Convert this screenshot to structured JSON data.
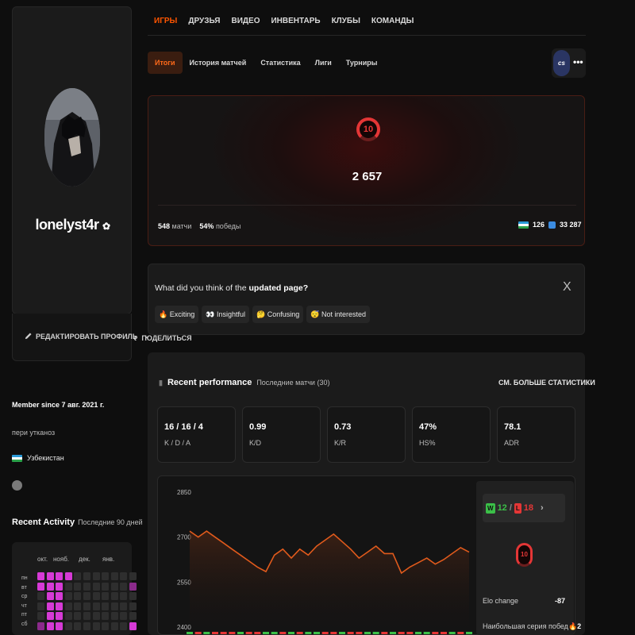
{
  "profile": {
    "username": "lonelyst4r",
    "edit_label": "РЕДАКТИРОВАТЬ ПРОФИЛЬ",
    "share_label": "ПОДЕЛИТЬСЯ",
    "member_since": "Member since 7 авг. 2021 г.",
    "bio": "пери утканоз",
    "country": "Узбекистан"
  },
  "activity": {
    "title": "Recent Activity",
    "subtitle": "Последние 90 дней",
    "months": [
      "окт.",
      "нояб.",
      "дек.",
      "янв."
    ],
    "days": [
      "пн",
      "вт",
      "ср",
      "чт",
      "пт",
      "сб"
    ]
  },
  "nav": {
    "tabs": [
      "ИГРЫ",
      "ДРУЗЬЯ",
      "ВИДЕО",
      "ИНВЕНТАРЬ",
      "КЛУБЫ",
      "КОМАНДЫ"
    ],
    "active": "ИГРЫ"
  },
  "subtabs": {
    "items": [
      "Итоги",
      "История матчей",
      "Статистика",
      "Лиги",
      "Турниры"
    ],
    "active": "Итоги",
    "game_badge": "cs",
    "more": "•••"
  },
  "elo": {
    "level": "10",
    "value": "2 657",
    "matches": "548",
    "matches_label": "матчи",
    "winrate": "54%",
    "winrate_label": "победы",
    "country_rank": "126",
    "world_rank": "33 287",
    "accent": "#e43636"
  },
  "feedback": {
    "question_prefix": "What did you think of the",
    "question_bold": "updated page?",
    "close": "X",
    "options": [
      {
        "icon": "🔥",
        "label": "Exciting"
      },
      {
        "icon": "👀",
        "label": "Insightful"
      },
      {
        "icon": "🤔",
        "label": "Confusing"
      },
      {
        "icon": "😴",
        "label": "Not interested"
      }
    ]
  },
  "performance": {
    "title": "Recent performance",
    "subtitle": "Последние матчи (30)",
    "more_link": "СМ. БОЛЬШЕ СТАТИСТИКИ",
    "stats": [
      {
        "value": "16 / 16 / 4",
        "label": "K / D / A"
      },
      {
        "value": "0.99",
        "label": "K/D"
      },
      {
        "value": "0.73",
        "label": "K/R"
      },
      {
        "value": "47%",
        "label": "HS%"
      },
      {
        "value": "78.1",
        "label": "ADR"
      }
    ],
    "wins": "12",
    "losses": "18",
    "wins_badge": "W",
    "losses_badge": "L",
    "elo_level": "10",
    "elo_change_label": "Elo change",
    "elo_change": "-87",
    "streak_label": "Наибольшая серия побед",
    "streak": "2"
  },
  "chart_data": {
    "type": "line",
    "yticks": [
      2850,
      2700,
      2550,
      2400
    ],
    "ylim": [
      2400,
      2850
    ],
    "values": [
      2720,
      2700,
      2720,
      2700,
      2680,
      2660,
      2640,
      2620,
      2600,
      2585,
      2640,
      2660,
      2630,
      2660,
      2640,
      2670,
      2690,
      2710,
      2685,
      2660,
      2630,
      2650,
      2670,
      2645,
      2645,
      2580,
      2600,
      2615,
      2630,
      2610,
      2625,
      2645,
      2665,
      2650
    ],
    "line_color": "#e05a1c",
    "results": [
      "W",
      "L",
      "W",
      "L",
      "L",
      "L",
      "W",
      "L",
      "L",
      "W",
      "W",
      "L",
      "W",
      "L",
      "W",
      "W",
      "L",
      "L",
      "W",
      "L",
      "L",
      "W",
      "W",
      "L",
      "W",
      "L",
      "L",
      "W",
      "W",
      "L",
      "L",
      "W",
      "L",
      "W"
    ]
  }
}
